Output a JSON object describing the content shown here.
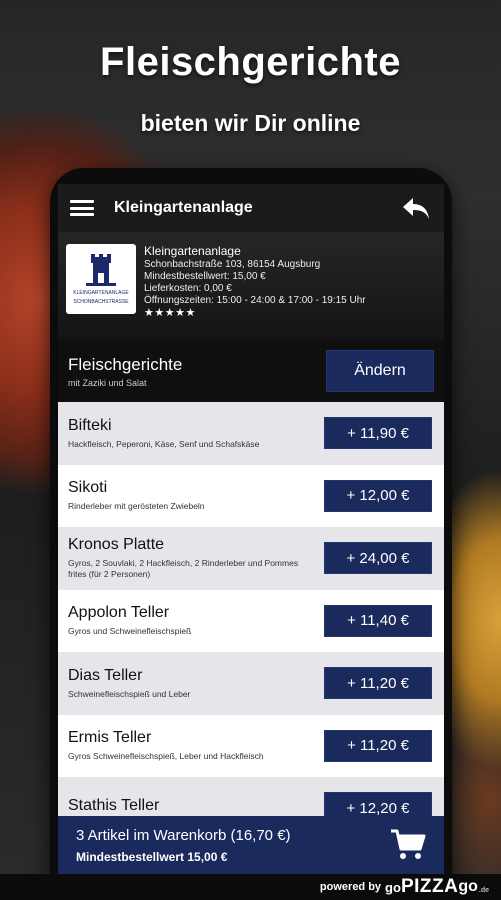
{
  "promo": {
    "headline": "Fleischgerichte",
    "subline": "bieten wir Dir online"
  },
  "appbar": {
    "title": "Kleingartenanlage",
    "menu_icon": "hamburger-icon",
    "back_icon": "back-arrow-icon"
  },
  "store": {
    "logo_text_1": "KLEINGARTENANLAGE",
    "logo_text_2": "SCHONBACHSTRASSE",
    "name": "Kleingartenanlage",
    "address": "Schonbachstraße 103, 86154 Augsburg",
    "min_order": "Mindestbestellwert: 15,00 €",
    "delivery_cost": "Lieferkosten: 0,00 €",
    "hours": "Öffnungszeiten: 15:00 - 24:00 & 17:00 - 19:15 Uhr",
    "rating_stars": "★★★★★"
  },
  "category": {
    "title": "Fleischgerichte",
    "subtitle": "mit Zaziki und Salat",
    "change_label": "Ändern"
  },
  "items": [
    {
      "name": "Bifteki",
      "desc": "Hackfleisch, Peperoni, Käse, Senf und Schafskäse",
      "price": "+ 11,90 €"
    },
    {
      "name": "Sikoti",
      "desc": "Rinderleber mit gerösteten Zwiebeln",
      "price": "+ 12,00 €"
    },
    {
      "name": "Kronos Platte",
      "desc": "Gyros, 2 Souvlaki, 2 Hackfleisch, 2 Rinderleber und Pommes frites (für 2 Personen)",
      "price": "+ 24,00 €"
    },
    {
      "name": "Appolon Teller",
      "desc": "Gyros und Schweinefleischspieß",
      "price": "+ 11,40 €"
    },
    {
      "name": "Dias Teller",
      "desc": "Schweinefleischspieß und Leber",
      "price": "+ 11,20 €"
    },
    {
      "name": "Ermis Teller",
      "desc": "Gyros Schweinefleischspieß, Leber und Hackfleisch",
      "price": "+ 11,20 €"
    },
    {
      "name": "Stathis Teller",
      "desc": "",
      "price": "+ 12,20 €"
    }
  ],
  "cart": {
    "summary": "3 Artikel im Warenkorb (16,70 €)",
    "min_order": "Mindestbestellwert 15,00 €",
    "icon": "shopping-cart-icon"
  },
  "footer": {
    "powered": "powered by",
    "go": "go",
    "brand": "PIZZA",
    "brand_go": "go",
    "domain": ".de"
  },
  "colors": {
    "accent": "#1a2a5c",
    "appbar": "#1b1b1b"
  }
}
